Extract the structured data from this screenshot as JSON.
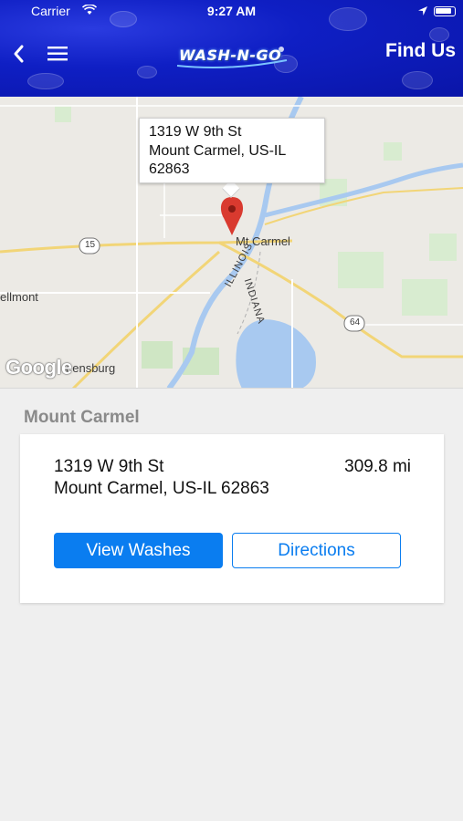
{
  "status_bar": {
    "carrier": "Carrier",
    "time": "9:27 AM"
  },
  "header": {
    "logo_text": "WASH-N-GO",
    "title": "Find Us",
    "back_icon": "chevron-left-icon",
    "menu_icon": "hamburger-menu-icon",
    "background_color": "#0f1fc4"
  },
  "map": {
    "callout": {
      "line1": "1319 W 9th St",
      "line2": "Mount Carmel, US-IL",
      "line3": "62863"
    },
    "labels": {
      "city": "Mt Carmel",
      "bellmont": "ellmont",
      "greensburg": "eensburg",
      "illinois": "ILLINOIS",
      "indiana": "INDIANA",
      "route_15": "15",
      "route_64": "64"
    },
    "attribution": "Google",
    "pin_color": "#d93a2f"
  },
  "location": {
    "section_title": "Mount Carmel",
    "address_line1": "1319 W 9th St",
    "address_line2": "Mount Carmel, US-IL  62863",
    "distance": "309.8 mi",
    "view_washes_label": "View Washes",
    "directions_label": "Directions",
    "accent_color": "#0a7df0"
  }
}
